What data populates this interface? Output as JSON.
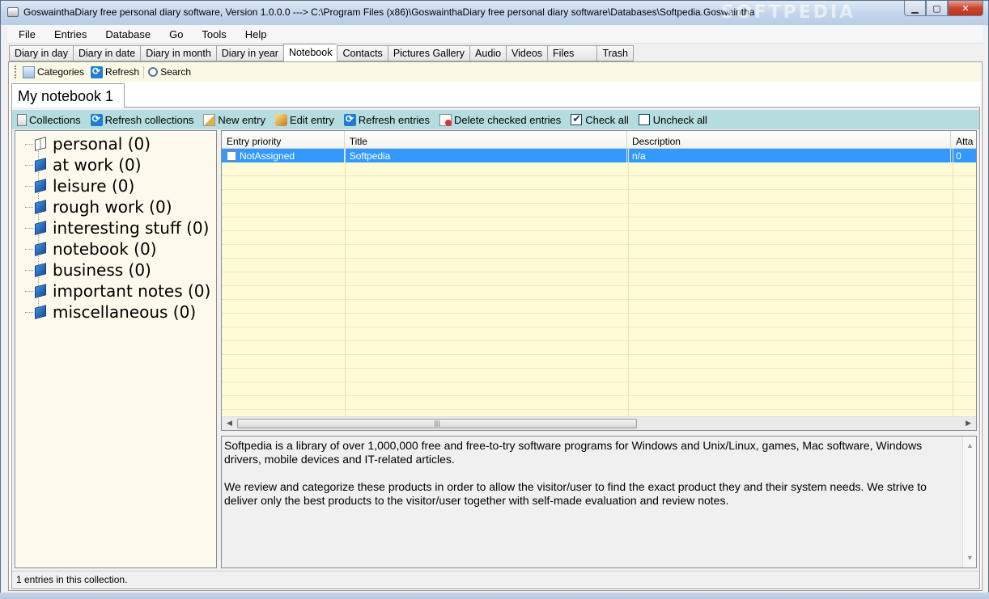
{
  "window": {
    "title": "GoswainthaDiary free personal diary software, Version 1.0.0.0 ---> C:\\Program Files (x86)\\GoswainthaDiary free personal diary software\\Databases\\Softpedia.Goswaintha",
    "watermark": "SOFTPEDIA",
    "buttons": {
      "minimize": "▁",
      "maximize": "▢",
      "close": "✕"
    }
  },
  "menu": [
    "File",
    "Entries",
    "Database",
    "Go",
    "Tools",
    "Help"
  ],
  "tabs": [
    "Diary in day",
    "Diary in date",
    "Diary in month",
    "Diary in year",
    "Notebook",
    "Contacts",
    "Pictures Gallery",
    "Audio",
    "Videos",
    "Files",
    "Trash"
  ],
  "active_tab": "Notebook",
  "toolbar": {
    "categories": "Categories",
    "refresh": "Refresh",
    "search": "Search"
  },
  "notebook": {
    "tab_label": "My notebook 1"
  },
  "entries_toolbar": {
    "collections": "Collections",
    "refresh_collections": "Refresh collections",
    "new_entry": "New entry",
    "edit_entry": "Edit entry",
    "refresh_entries": "Refresh entries",
    "delete_checked": "Delete checked entries",
    "check_all": "Check all",
    "uncheck_all": "Uncheck all"
  },
  "collections": [
    {
      "label": "personal (0)",
      "icon": "open-book-icon"
    },
    {
      "label": "at work (0)",
      "icon": "book-icon"
    },
    {
      "label": "leisure (0)",
      "icon": "book-icon"
    },
    {
      "label": "rough work (0)",
      "icon": "book-icon"
    },
    {
      "label": "interesting stuff (0)",
      "icon": "book-icon"
    },
    {
      "label": "notebook (0)",
      "icon": "book-icon"
    },
    {
      "label": "business (0)",
      "icon": "book-icon"
    },
    {
      "label": "important notes (0)",
      "icon": "book-icon"
    },
    {
      "label": "miscellaneous (0)",
      "icon": "book-icon"
    }
  ],
  "grid": {
    "columns": [
      "Entry priority",
      "Title",
      "Description",
      "Atta"
    ],
    "rows": [
      {
        "priority": "NotAssigned",
        "title": "Softpedia",
        "description": "n/a",
        "attachments": "0"
      }
    ]
  },
  "description_text": {
    "p1": "Softpedia is a library of over 1,000,000 free and free-to-try software programs for Windows and Unix/Linux, games, Mac software, Windows drivers, mobile devices and IT-related articles.",
    "p2": "We review and categorize these products in order to allow the visitor/user to find the exact product they and their system needs. We strive to deliver only the best products to the visitor/user together with self-made evaluation and review notes."
  },
  "status": "1 entries in this collection.",
  "colors": {
    "selection": "#3399ff",
    "entries_toolbar_bg": "#b5dde0",
    "grid_bg": "#fefcd6",
    "tree_bg": "#fdf9ec"
  }
}
